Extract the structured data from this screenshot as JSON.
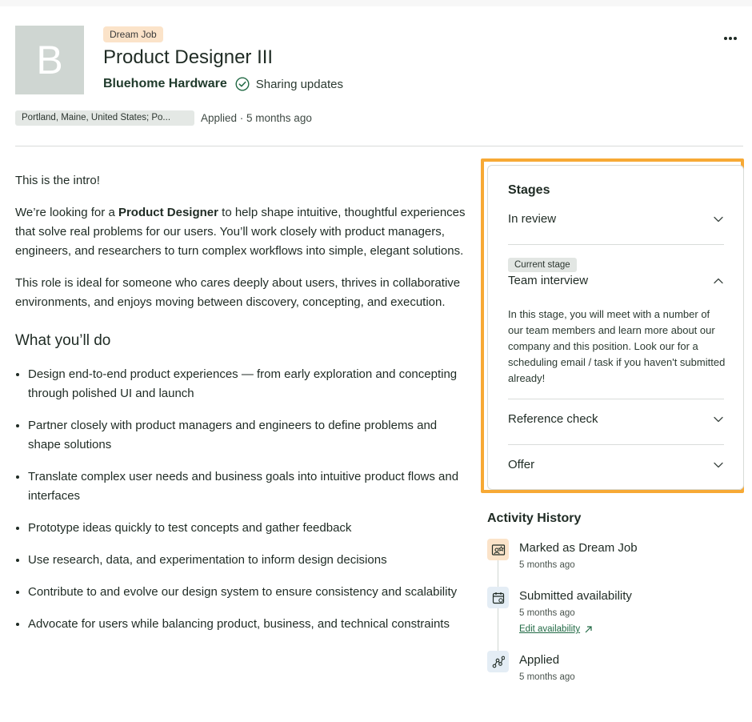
{
  "header": {
    "logo_letter": "B",
    "badge": "Dream Job",
    "title": "Product Designer III",
    "company": "Bluehome Hardware",
    "sharing_status": "Sharing updates",
    "location": "Portland, Maine, United States; Po...",
    "applied": "Applied · 5 months ago"
  },
  "content": {
    "intro": "This is the intro!",
    "para1_pre": "We’re looking for a ",
    "para1_bold": "Product Designer",
    "para1_post": " to help shape intuitive, thoughtful experiences that solve real problems for our users. You’ll work closely with product managers, engineers, and researchers to turn complex workflows into simple, elegant solutions.",
    "para2": "This role is ideal for someone who cares deeply about users, thrives in collaborative environments, and enjoys moving between discovery, concepting, and execution.",
    "section_heading": "What you’ll do",
    "bullets": [
      "Design end-to-end product experiences — from early exploration and concepting through polished UI and launch",
      "Partner closely with product managers and engineers to define problems and shape solutions",
      "Translate complex user needs and business goals into intuitive product flows and interfaces",
      "Prototype ideas quickly to test concepts and gather feedback",
      "Use research, data, and experimentation to inform design decisions",
      "Contribute to and evolve our design system to ensure consistency and scalability",
      "Advocate for users while balancing product, business, and technical constraints"
    ]
  },
  "stages": {
    "heading": "Stages",
    "current_badge": "Current stage",
    "items": [
      {
        "label": "In review"
      },
      {
        "label": "Team interview",
        "expanded": true,
        "description": "In this stage, you will meet with a number of our team members and learn more about our company and this position. Look our for a scheduling email / task if you haven't submitted already!"
      },
      {
        "label": "Reference check"
      },
      {
        "label": "Offer"
      }
    ]
  },
  "activity": {
    "heading": "Activity History",
    "items": [
      {
        "title": "Marked as Dream Job",
        "time": "5 months ago",
        "icon": "dream-job-icon"
      },
      {
        "title": "Submitted availability",
        "time": "5 months ago",
        "link": "Edit availability",
        "icon": "calendar-icon"
      },
      {
        "title": "Applied",
        "time": "5 months ago",
        "icon": "route-icon"
      }
    ]
  },
  "colors": {
    "accent_green": "#226a45",
    "highlight_orange": "#f7a935",
    "badge_peach": "#fbe3c9"
  }
}
